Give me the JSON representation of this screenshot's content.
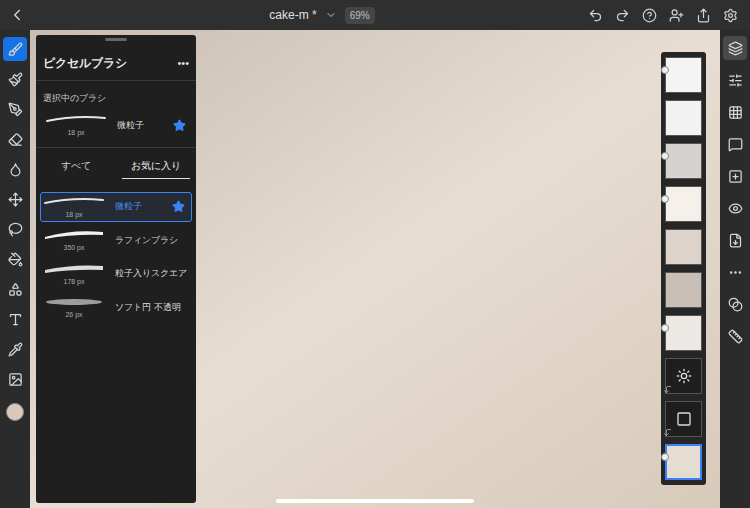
{
  "top_bar": {
    "title": "cake-m *",
    "zoom": "69%"
  },
  "left_tools": [
    {
      "selected": true
    },
    {
      "selected": false
    },
    {
      "selected": false
    },
    {
      "selected": false
    },
    {
      "selected": false
    },
    {
      "selected": false
    },
    {
      "selected": false
    },
    {
      "selected": false
    },
    {
      "selected": false
    },
    {
      "selected": false
    },
    {
      "selected": false
    },
    {
      "selected": false
    }
  ],
  "current_color": "#d9c9bc",
  "brush_panel": {
    "title": "ピクセルブラシ",
    "menu": "•••",
    "selected_label": "選択中のブラシ",
    "selected_brush": {
      "name": "微粒子",
      "size": "18 px",
      "favorite": true
    },
    "tabs": [
      {
        "label": "すべて",
        "selected": false
      },
      {
        "label": "お気に入り",
        "selected": true
      }
    ],
    "brushes": [
      {
        "name": "微粒子",
        "size": "18 px",
        "selected": true,
        "favorite": true
      },
      {
        "name": "ラフィンブラシ",
        "size": "350 px",
        "selected": false,
        "favorite": false
      },
      {
        "name": "粒子入りスクエア",
        "size": "178 px",
        "selected": false,
        "favorite": false
      },
      {
        "name": "ソフト円 不透明",
        "size": "26 px",
        "selected": false,
        "favorite": false
      }
    ]
  },
  "layers": [
    {
      "kind": "pixel",
      "color": "#f4f4f4",
      "selected": false,
      "clipped": false,
      "visible_marker": true
    },
    {
      "kind": "pixel",
      "color": "#f2f2f2",
      "selected": false,
      "clipped": false,
      "visible_marker": false
    },
    {
      "kind": "pixel",
      "color": "#d6d2d0",
      "selected": false,
      "clipped": false,
      "visible_marker": true
    },
    {
      "kind": "pixel",
      "color": "#f5f0ea",
      "selected": false,
      "clipped": false,
      "visible_marker": true
    },
    {
      "kind": "pixel",
      "color": "#ddd3cb",
      "selected": false,
      "clipped": false,
      "visible_marker": false
    },
    {
      "kind": "pixel",
      "color": "#c9bfb6",
      "selected": false,
      "clipped": false,
      "visible_marker": false
    },
    {
      "kind": "pixel",
      "color": "#ece8e4",
      "selected": false,
      "clipped": false,
      "visible_marker": true
    },
    {
      "kind": "adjustment",
      "color": "#1e1e1e",
      "selected": false,
      "clipped": true,
      "visible_marker": false
    },
    {
      "kind": "adjustment",
      "color": "#1e1e1e",
      "selected": false,
      "clipped": true,
      "visible_marker": false
    },
    {
      "kind": "pixel",
      "color": "#e6ddd2",
      "selected": true,
      "clipped": false,
      "visible_marker": true
    }
  ],
  "right_tools": [
    {
      "selected": true
    },
    {
      "selected": false
    },
    {
      "selected": false
    },
    {
      "selected": false
    },
    {
      "selected": false
    },
    {
      "selected": false
    },
    {
      "selected": false
    },
    {
      "selected": false
    },
    {
      "selected": false
    },
    {
      "selected": false
    }
  ]
}
